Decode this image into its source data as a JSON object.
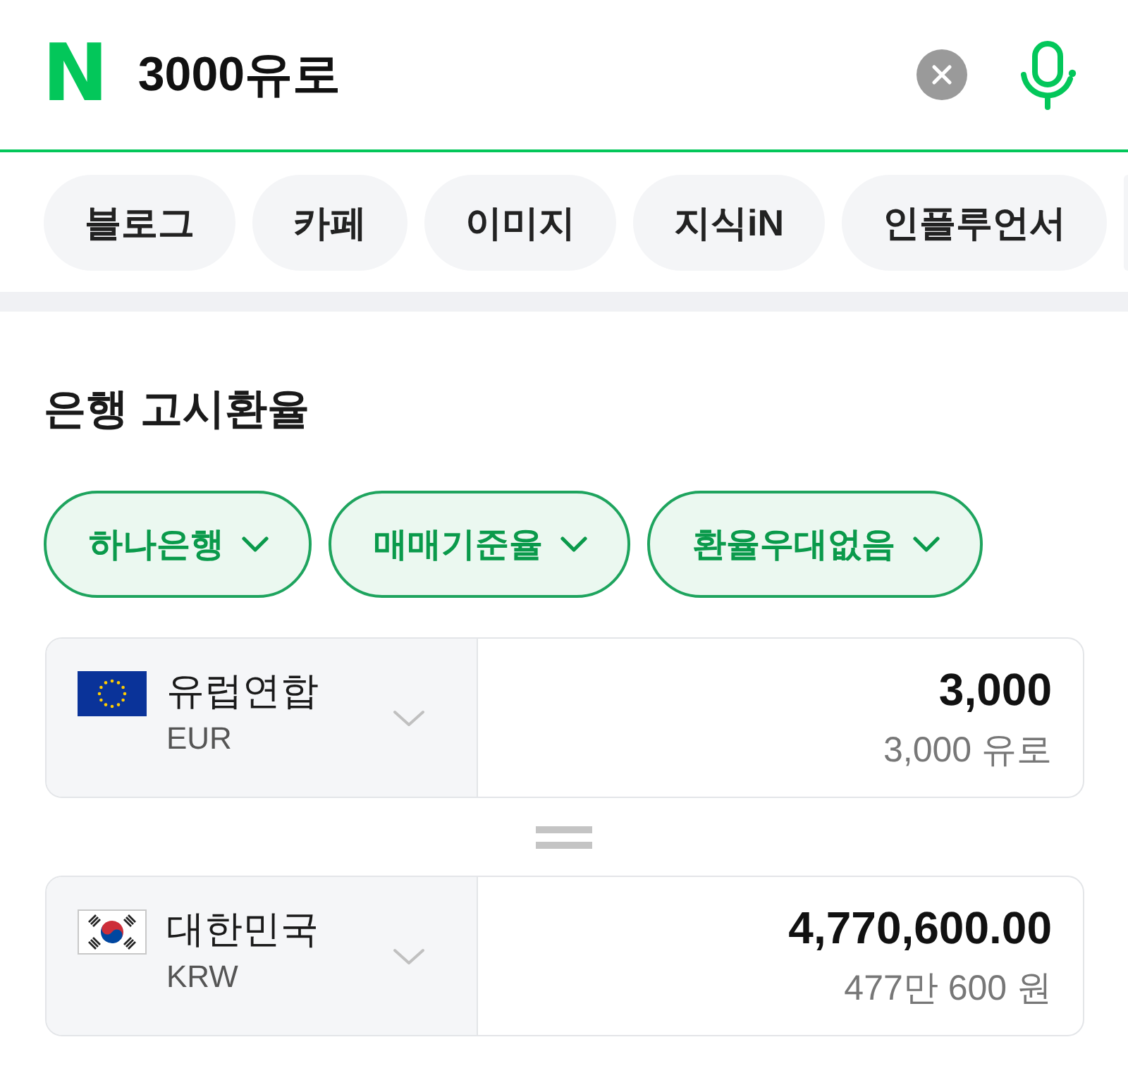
{
  "search": {
    "logo": "N",
    "query": "3000유로"
  },
  "tabs": [
    {
      "label": "블로그",
      "selected": false
    },
    {
      "label": "카페",
      "selected": false
    },
    {
      "label": "이미지",
      "selected": false
    },
    {
      "label": "지식iN",
      "selected": false
    },
    {
      "label": "인플루언서",
      "selected": false
    }
  ],
  "rates": {
    "title": "은행 고시환율",
    "filters": [
      {
        "label": "하나은행"
      },
      {
        "label": "매매기준율"
      },
      {
        "label": "환율우대없음"
      }
    ],
    "currencies": [
      {
        "kind": "eu",
        "name": "유럽연합",
        "code": "EUR",
        "amount": "3,000",
        "amount_text": "3,000 유로"
      },
      {
        "kind": "kr",
        "name": "대한민국",
        "code": "KRW",
        "amount": "4,770,600.00",
        "amount_text": "477만 600 원"
      }
    ]
  }
}
